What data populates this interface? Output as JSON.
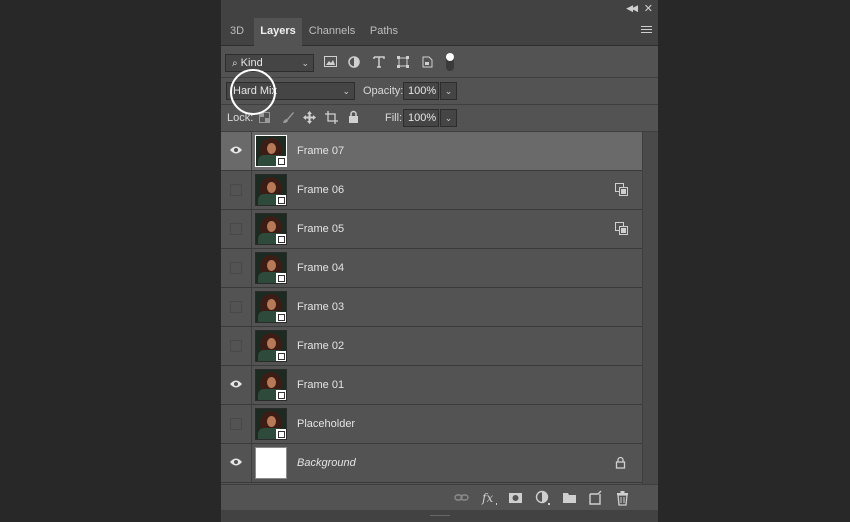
{
  "tabs": [
    {
      "label": "3D",
      "active": false
    },
    {
      "label": "Layers",
      "active": true
    },
    {
      "label": "Channels",
      "active": false
    },
    {
      "label": "Paths",
      "active": false
    }
  ],
  "filter": {
    "kind_label": "Kind"
  },
  "blend": {
    "mode": "Hard Mix",
    "opacity_label": "Opacity:",
    "opacity_value": "100%"
  },
  "lock": {
    "label": "Lock:",
    "fill_label": "Fill:",
    "fill_value": "100%"
  },
  "layers": [
    {
      "name": "Frame 07",
      "visible": true,
      "selected": true,
      "badge": false,
      "thumb": "photo"
    },
    {
      "name": "Frame 06",
      "visible": false,
      "selected": false,
      "badge": true,
      "thumb": "photo"
    },
    {
      "name": "Frame 05",
      "visible": false,
      "selected": false,
      "badge": true,
      "thumb": "photo"
    },
    {
      "name": "Frame 04",
      "visible": false,
      "selected": false,
      "badge": false,
      "thumb": "photo"
    },
    {
      "name": "Frame 03",
      "visible": false,
      "selected": false,
      "badge": false,
      "thumb": "photo"
    },
    {
      "name": "Frame 02",
      "visible": false,
      "selected": false,
      "badge": false,
      "thumb": "photo"
    },
    {
      "name": "Frame 01",
      "visible": true,
      "selected": false,
      "badge": false,
      "thumb": "photo"
    },
    {
      "name": "Placeholder",
      "visible": false,
      "selected": false,
      "badge": false,
      "thumb": "photo"
    },
    {
      "name": "Background",
      "visible": true,
      "selected": false,
      "badge": false,
      "thumb": "white",
      "locked": true,
      "italic": true
    }
  ],
  "bottom_icons": [
    "link-icon",
    "fx-icon",
    "mask-icon",
    "adjustment-icon",
    "folder-icon",
    "new-layer-icon",
    "trash-icon"
  ],
  "colors": {
    "panel": "#535353",
    "selected_row": "#6a6a6a",
    "background": "#282828"
  }
}
